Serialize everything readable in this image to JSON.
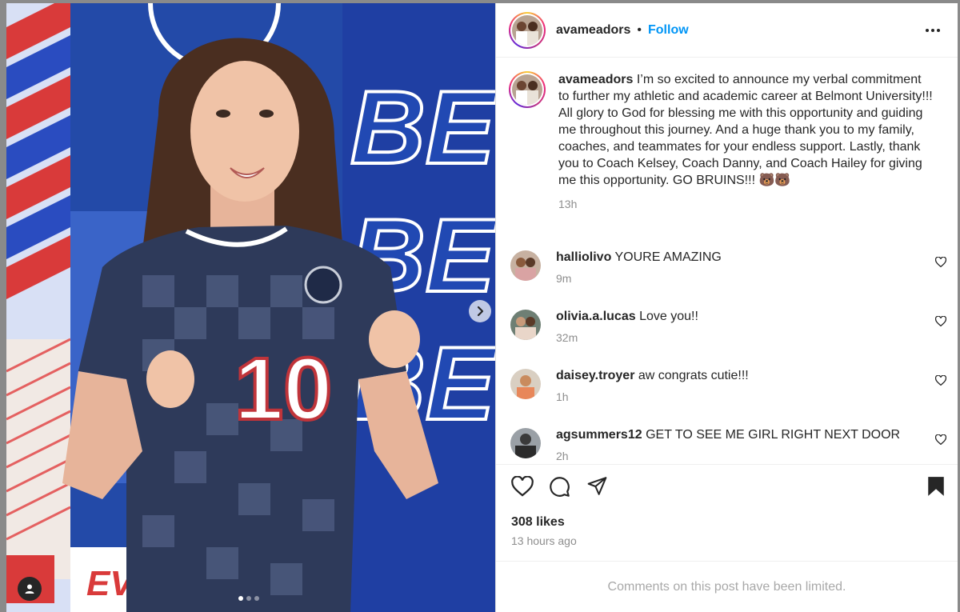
{
  "post": {
    "username": "avameadors",
    "separator": "•",
    "follow_label": "Follow",
    "more_icon": "more-horizontal-icon",
    "caption": "I’m so excited to announce my verbal commitment to further my athletic and academic career at Belmont University!!! All glory to God for blessing me with this opportunity and guiding me throughout this journey. And a huge thank you to my family, coaches, and teammates for your endless support. Lastly, thank you to Coach Kelsey, Coach Danny, and Coach Hailey for giving me this opportunity. GO BRUINS!!! 🐻🐻",
    "caption_time": "13h",
    "likes": "308 likes",
    "posted": "13 hours ago",
    "comments_limited": "Comments on this post have been limited.",
    "jersey_number": "10",
    "backdrop_text": "BE",
    "carousel_dots": 3,
    "active_dot": 0
  },
  "comments": [
    {
      "user": "halliolivo",
      "text": "YOURE AMAZING",
      "time": "9m"
    },
    {
      "user": "olivia.a.lucas",
      "text": "Love you!!",
      "time": "32m"
    },
    {
      "user": "daisey.troyer",
      "text": "aw congrats cutie!!!",
      "time": "1h"
    },
    {
      "user": "agsummers12",
      "text": "GET TO SEE ME GIRL RIGHT NEXT DOOR",
      "time": "2h"
    }
  ],
  "colors": {
    "link_blue": "#0095f6",
    "muted": "#8e8e8e",
    "backdrop_blue": "#1e3a9c",
    "jersey_navy": "#2e3a5a"
  }
}
